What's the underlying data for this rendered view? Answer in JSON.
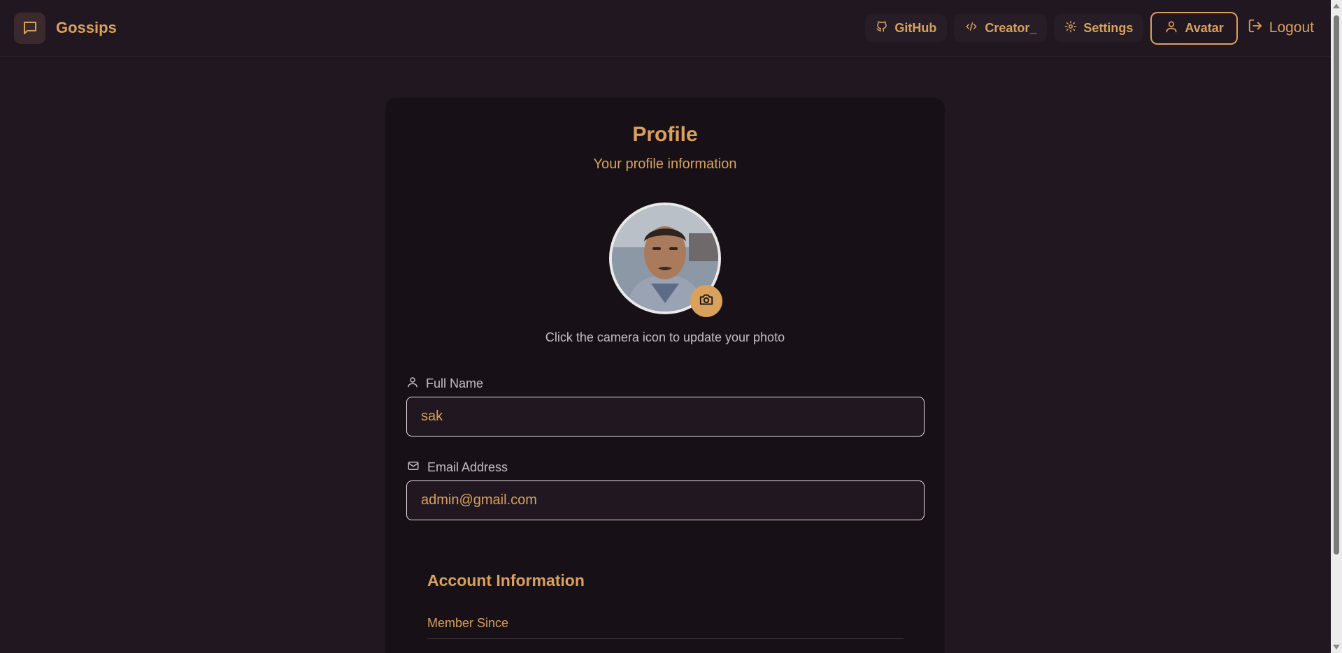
{
  "navbar": {
    "brand": "Gossips",
    "links": [
      {
        "label": "GitHub",
        "icon": "github-icon"
      },
      {
        "label": "Creator_",
        "icon": "code-icon"
      },
      {
        "label": "Settings",
        "icon": "gear-icon"
      },
      {
        "label": "Avatar",
        "icon": "user-icon"
      },
      {
        "label": "Logout",
        "icon": "logout-icon"
      }
    ]
  },
  "profile": {
    "title": "Profile",
    "subtitle": "Your profile information",
    "photo_hint": "Click the camera icon to update your photo",
    "fields": [
      {
        "label": "Full Name",
        "value": "sak",
        "icon": "user-icon"
      },
      {
        "label": "Email Address",
        "value": "admin@gmail.com",
        "icon": "mail-icon"
      }
    ]
  },
  "account": {
    "title": "Account Information",
    "member_since_label": "Member Since"
  },
  "colors": {
    "background": "#201721",
    "card": "#171117",
    "accent": "#d9a15c",
    "muted_text": "#c5bcc4"
  }
}
